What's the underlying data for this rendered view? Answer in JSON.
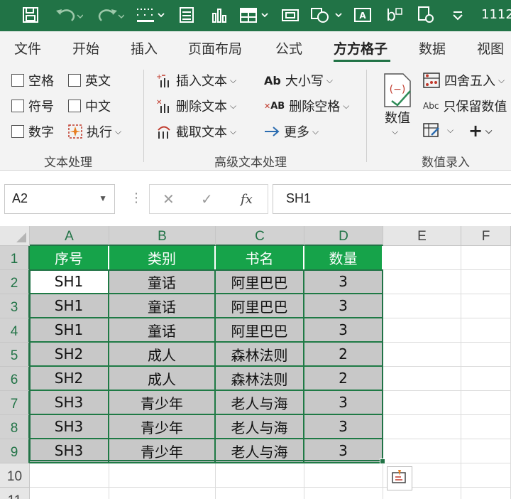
{
  "title_bar": {
    "title": "1112",
    "icons": [
      "save-icon",
      "undo-icon",
      "redo-icon",
      "border-icon",
      "form-icon",
      "chart-icon",
      "table-icon",
      "camera-icon",
      "shape-icon",
      "textbox-icon",
      "letter-format-icon",
      "painter-icon"
    ]
  },
  "menu": {
    "tabs": [
      "文件",
      "开始",
      "插入",
      "页面布局",
      "公式",
      "方方格子",
      "数据",
      "视图"
    ],
    "active_tab": "方方格子"
  },
  "ribbon": {
    "text_processing": {
      "label": "文本处理",
      "items": [
        "空格",
        "英文",
        "符号",
        "中文",
        "数字",
        "执行"
      ]
    },
    "advanced_text": {
      "label": "高级文本处理",
      "insert": "插入文本",
      "delete": "删除文本",
      "extract": "截取文本",
      "case": "大小写",
      "case_icon_text": "Ab",
      "delete_space": "删除空格",
      "delete_space_icon_text": "AB",
      "more": "更多"
    },
    "numeric": {
      "label": "数值录入",
      "value_button": "数值",
      "round": "四舍五入",
      "keep_values": "只保留数值",
      "keep_values_icon_text": "Abc"
    }
  },
  "formula_bar": {
    "name_box": "A2",
    "formula": "SH1",
    "fx": "fx"
  },
  "grid": {
    "columns": [
      "A",
      "B",
      "C",
      "D",
      "E",
      "F"
    ],
    "rows": [
      "1",
      "2",
      "3",
      "4",
      "5",
      "6",
      "7",
      "8",
      "9",
      "10",
      "11"
    ],
    "header_row": [
      "序号",
      "类别",
      "书名",
      "数量"
    ],
    "data": [
      [
        "SH1",
        "童话",
        "阿里巴巴",
        "3"
      ],
      [
        "SH1",
        "童话",
        "阿里巴巴",
        "3"
      ],
      [
        "SH1",
        "童话",
        "阿里巴巴",
        "3"
      ],
      [
        "SH2",
        "成人",
        "森林法则",
        "2"
      ],
      [
        "SH2",
        "成人",
        "森林法则",
        "2"
      ],
      [
        "SH3",
        "青少年",
        "老人与海",
        "3"
      ],
      [
        "SH3",
        "青少年",
        "老人与海",
        "3"
      ],
      [
        "SH3",
        "青少年",
        "老人与海",
        "3"
      ]
    ]
  },
  "colors": {
    "brand_green": "#217346",
    "header_fill": "#16a34a",
    "data_fill": "#c8c8c8"
  }
}
